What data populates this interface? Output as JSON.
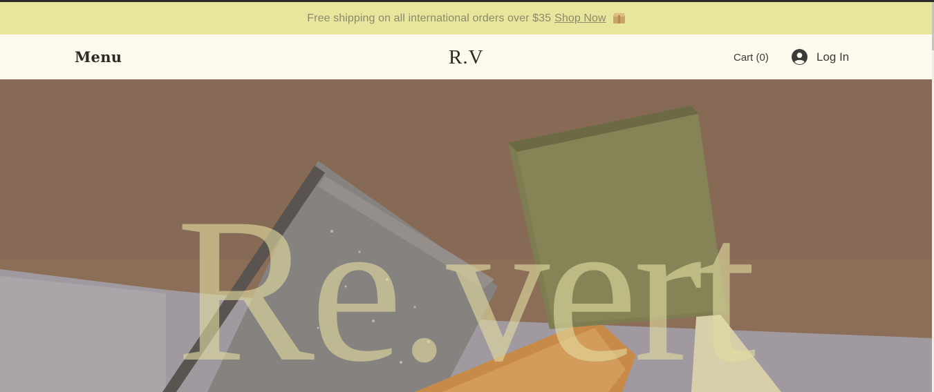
{
  "announcement": {
    "text": "Free shipping on all international orders over $35",
    "link_label": "Shop Now",
    "icon": "package-icon"
  },
  "header": {
    "menu_label": "Menu",
    "logo": "R.V",
    "cart_label": "Cart",
    "cart_count": "0",
    "login_label": "Log In",
    "avatar_icon": "user-avatar-icon"
  },
  "hero": {
    "title": "Re.vert"
  },
  "colors": {
    "announcement_bg": "#e8e59c",
    "header_bg": "#fdf9ec",
    "hero_bg": "#8b6d58",
    "hero_title": "#e1dca0"
  }
}
